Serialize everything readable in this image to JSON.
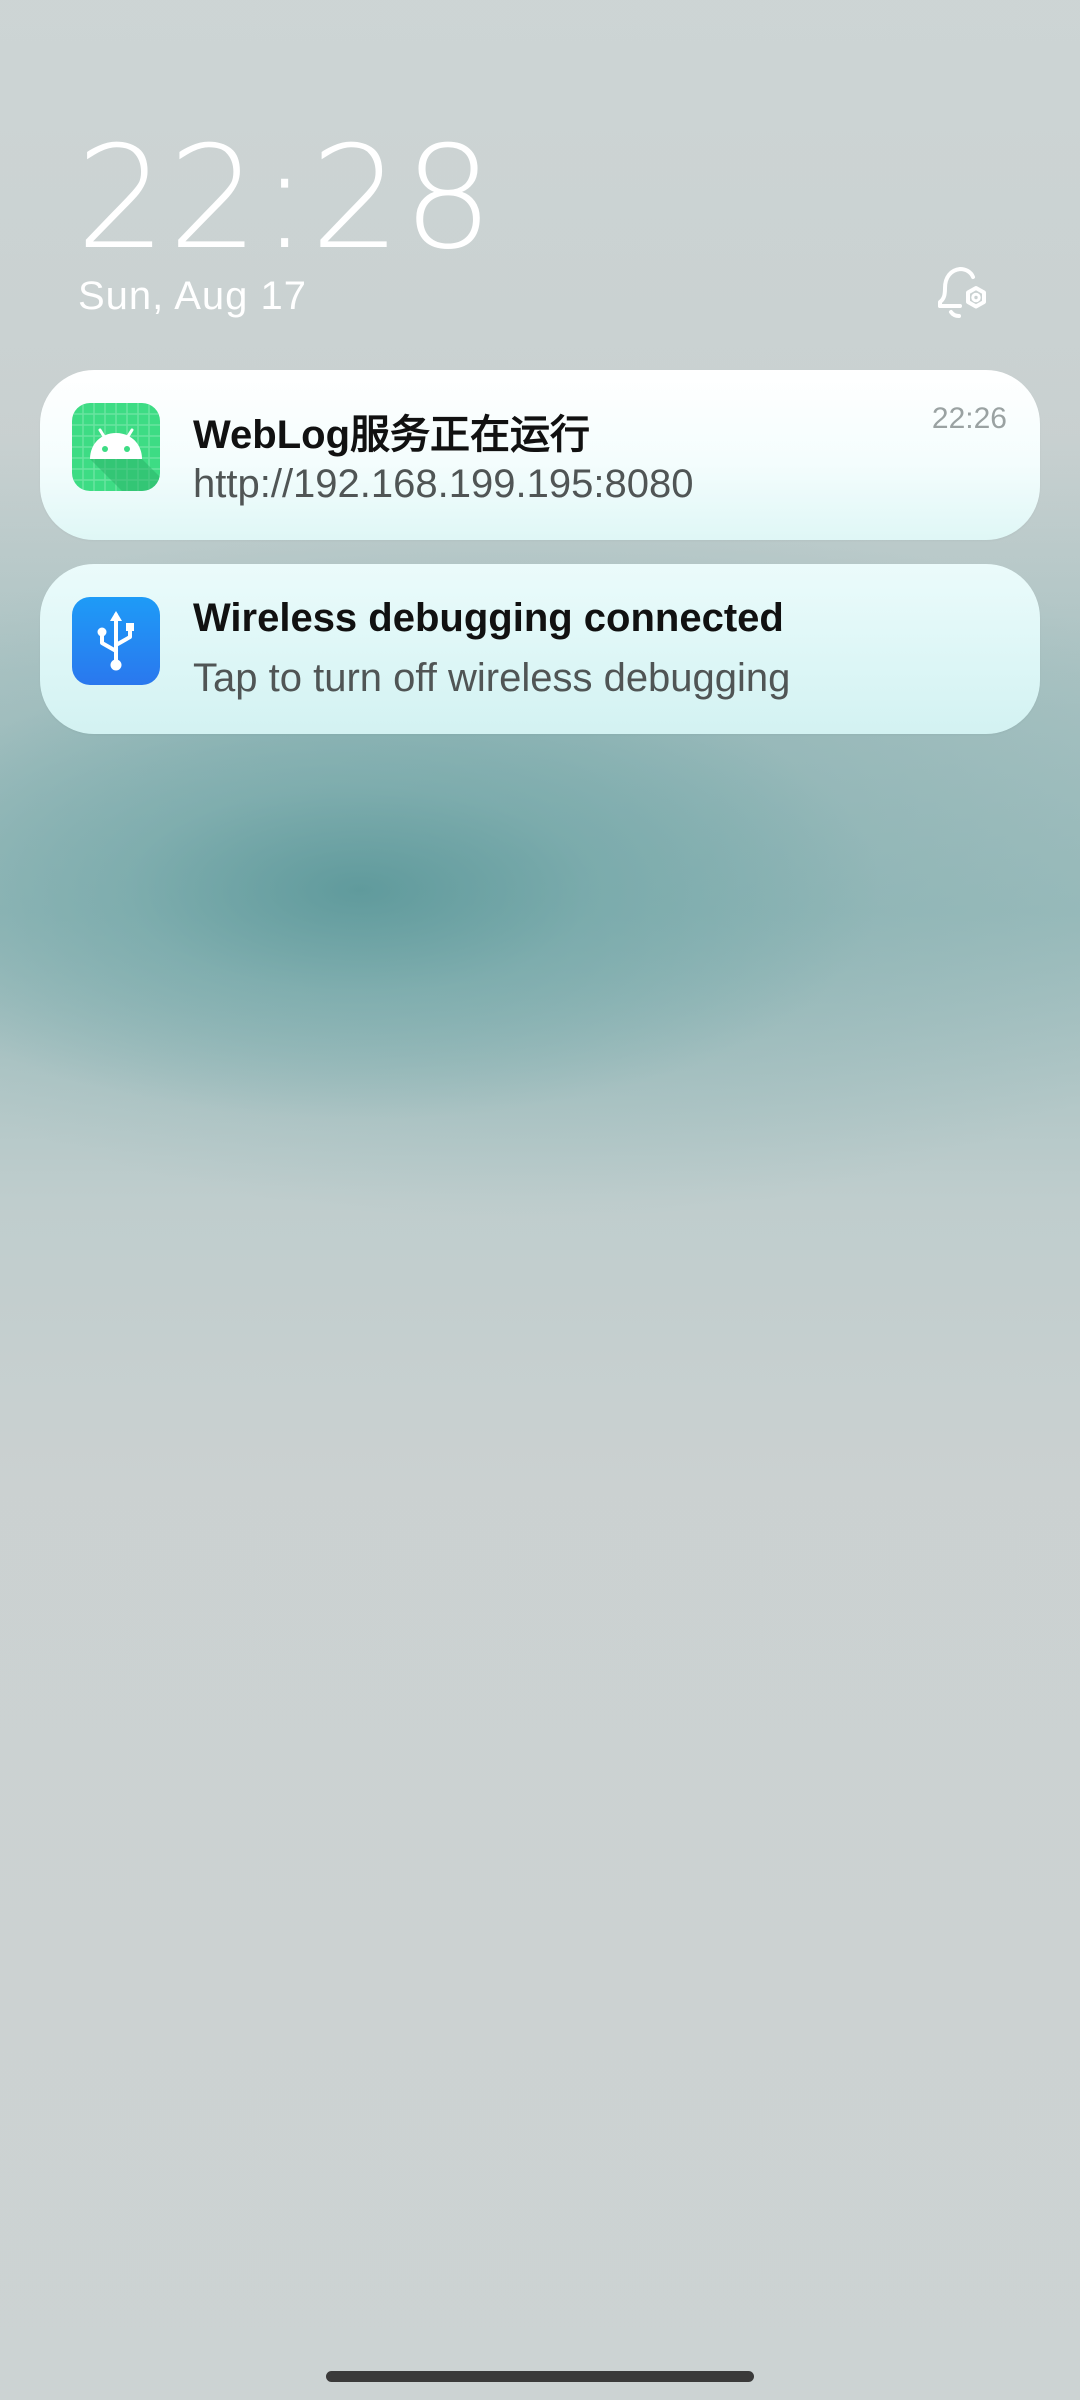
{
  "lockscreen": {
    "time": "22:28",
    "date": "Sun, Aug 17",
    "bell_icon": "notification-settings-icon"
  },
  "notifications": [
    {
      "app_icon": "android-icon",
      "title": "WebLog服务正在运行",
      "text": "http://192.168.199.195:8080",
      "time": "22:26"
    },
    {
      "app_icon": "usb-icon",
      "title": "Wireless debugging connected",
      "text": "Tap to turn off wireless debugging"
    }
  ],
  "colors": {
    "android_icon_green": "#3ddc84",
    "usb_icon_blue": "#2b8cf5"
  }
}
